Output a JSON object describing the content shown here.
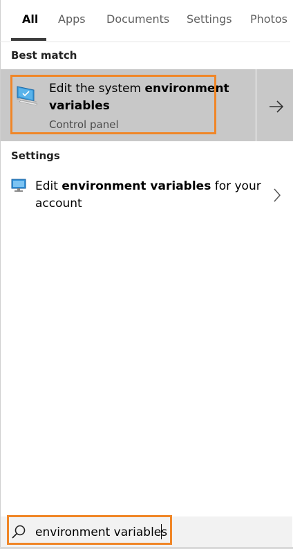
{
  "tabs": [
    {
      "label": "All",
      "active": true
    },
    {
      "label": "Apps"
    },
    {
      "label": "Documents"
    },
    {
      "label": "Settings"
    },
    {
      "label": "Photos"
    }
  ],
  "best_match": {
    "section_title": "Best match",
    "title_plain": "Edit the system ",
    "title_bold_1": "environment",
    "title_bold_2": "variables",
    "subtitle": "Control panel",
    "icon": "system-properties-icon",
    "arrow_icon": "arrow-right-icon"
  },
  "settings": {
    "section_title": "Settings",
    "item": {
      "prefix": "Edit ",
      "bold": "environment variables",
      "suffix": " for your",
      "line2": "account",
      "icon": "monitor-settings-icon"
    }
  },
  "search": {
    "value": "environment variables",
    "icon": "search-icon"
  },
  "colors": {
    "highlight": "#f08627",
    "selected_row": "#c8c8c8",
    "search_bg": "#f2f2f2"
  }
}
